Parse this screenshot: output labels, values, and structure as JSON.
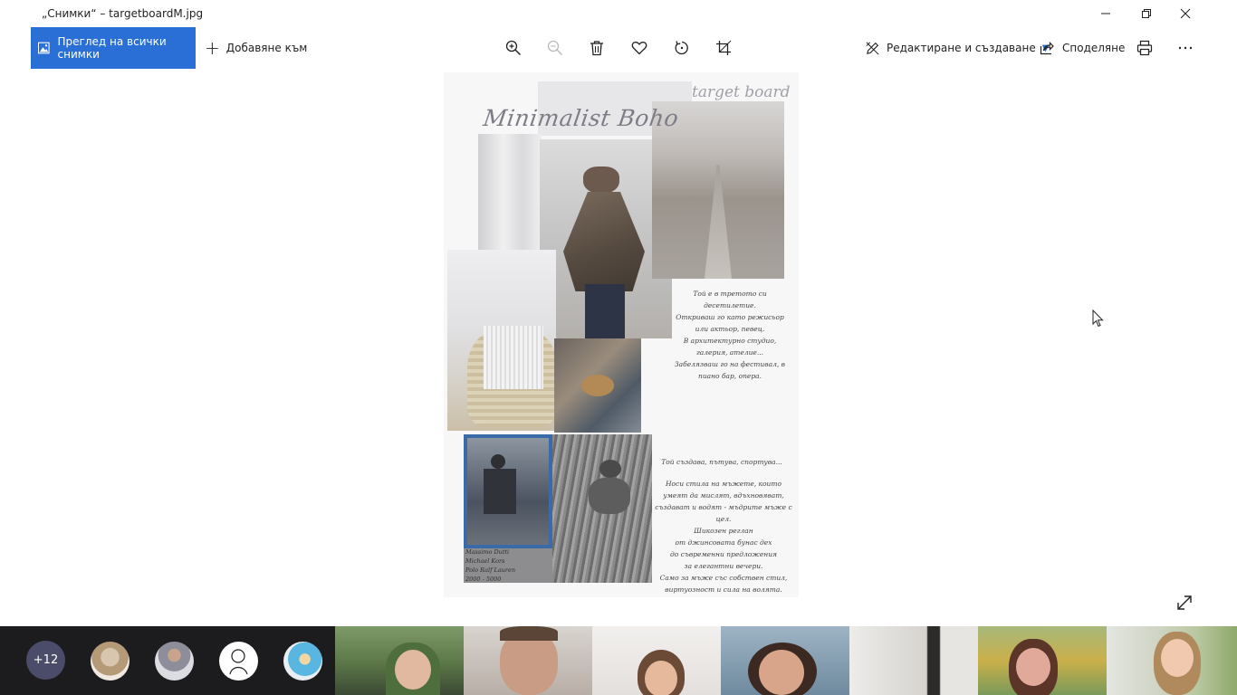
{
  "window": {
    "title": "„Снимки“ – targetboardM.jpg"
  },
  "toolbar": {
    "all_photos_label": "Преглед на всички снимки",
    "add_label": "Добавяне към",
    "edit_label": "Редактиране и създаване",
    "share_label": "Споделяне"
  },
  "moodboard": {
    "title": "Minimalist Boho",
    "subtitle": "target board",
    "caption1": [
      "Той е в третото си десетилетие.",
      "Откриваш го като режисьор",
      "или актьор, певец.",
      "В архитектурно студио,",
      "галерия, ателие...",
      "Забелязваш го на фестивал, в",
      "пиано бар, опера."
    ],
    "caption2_head": "Той създава, пътува, спортува...",
    "caption3": [
      "Носи стила на мъжете, които",
      "умеят да мислят, вдъхновяват,",
      "създават и водят - мъдрите мъже с цел.",
      "Шикозен реглан",
      "от джинсовата бунас дех",
      "до съвременни предложения",
      "за елегантни вечери.",
      "Само за мъже със собствен стил,",
      "виртуозност и сила на волята."
    ],
    "brands": [
      "Massimo Dutti",
      "Michael Kors",
      "Polo Ralf Lauren",
      "2000 - 5000"
    ]
  },
  "meeting": {
    "extra_participants": "+12"
  },
  "colors": {
    "accent": "#2a6fd6",
    "strip_bg": "#1c1c1f",
    "badge_bg": "#4a4c6a"
  }
}
